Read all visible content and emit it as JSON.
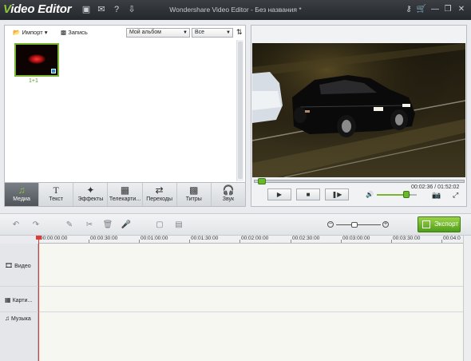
{
  "app": {
    "logo_initial": "V",
    "logo_rest": "ideo Editor",
    "window_title": "Wondershare Video Editor - Без названия *"
  },
  "titlebar_icons": [
    "save-icon",
    "chat-icon",
    "help-icon",
    "download-icon"
  ],
  "window_buttons": [
    "key-icon",
    "cart-icon",
    "minimize-icon",
    "restore-icon",
    "close-icon"
  ],
  "media": {
    "import_label": "Импорт",
    "record_label": "Запись",
    "album_select": "Мой альбом",
    "filter_select": "Все",
    "clip_label": "1+1"
  },
  "media_tabs": [
    {
      "label": "Медиа",
      "icon": "media-icon",
      "active": true
    },
    {
      "label": "Текст",
      "icon": "text-icon"
    },
    {
      "label": "Эффекты",
      "icon": "effects-icon"
    },
    {
      "label": "Телекарти...",
      "icon": "pip-icon"
    },
    {
      "label": "Переходы",
      "icon": "transitions-icon"
    },
    {
      "label": "Титры",
      "icon": "titles-icon"
    },
    {
      "label": "Звук",
      "icon": "sound-icon"
    }
  ],
  "player": {
    "timecode": "00:02:36 / 01:52:02",
    "progress_fraction": 0.023,
    "volume_fraction": 0.72
  },
  "export": {
    "label": "Экспорт",
    "accent": "#67b82b"
  },
  "timeline": {
    "ruler_labels": [
      "00:00:00:00",
      "00:00:30:00",
      "00:01:00:00",
      "00:01:30:00",
      "00:02:00:00",
      "00:02:30:00",
      "00:03:00:00",
      "00:03:30:00",
      "00:04:0"
    ],
    "tracks": [
      "Видео",
      "Карти...",
      "Музыка"
    ],
    "zoom_fraction": 0.42
  }
}
